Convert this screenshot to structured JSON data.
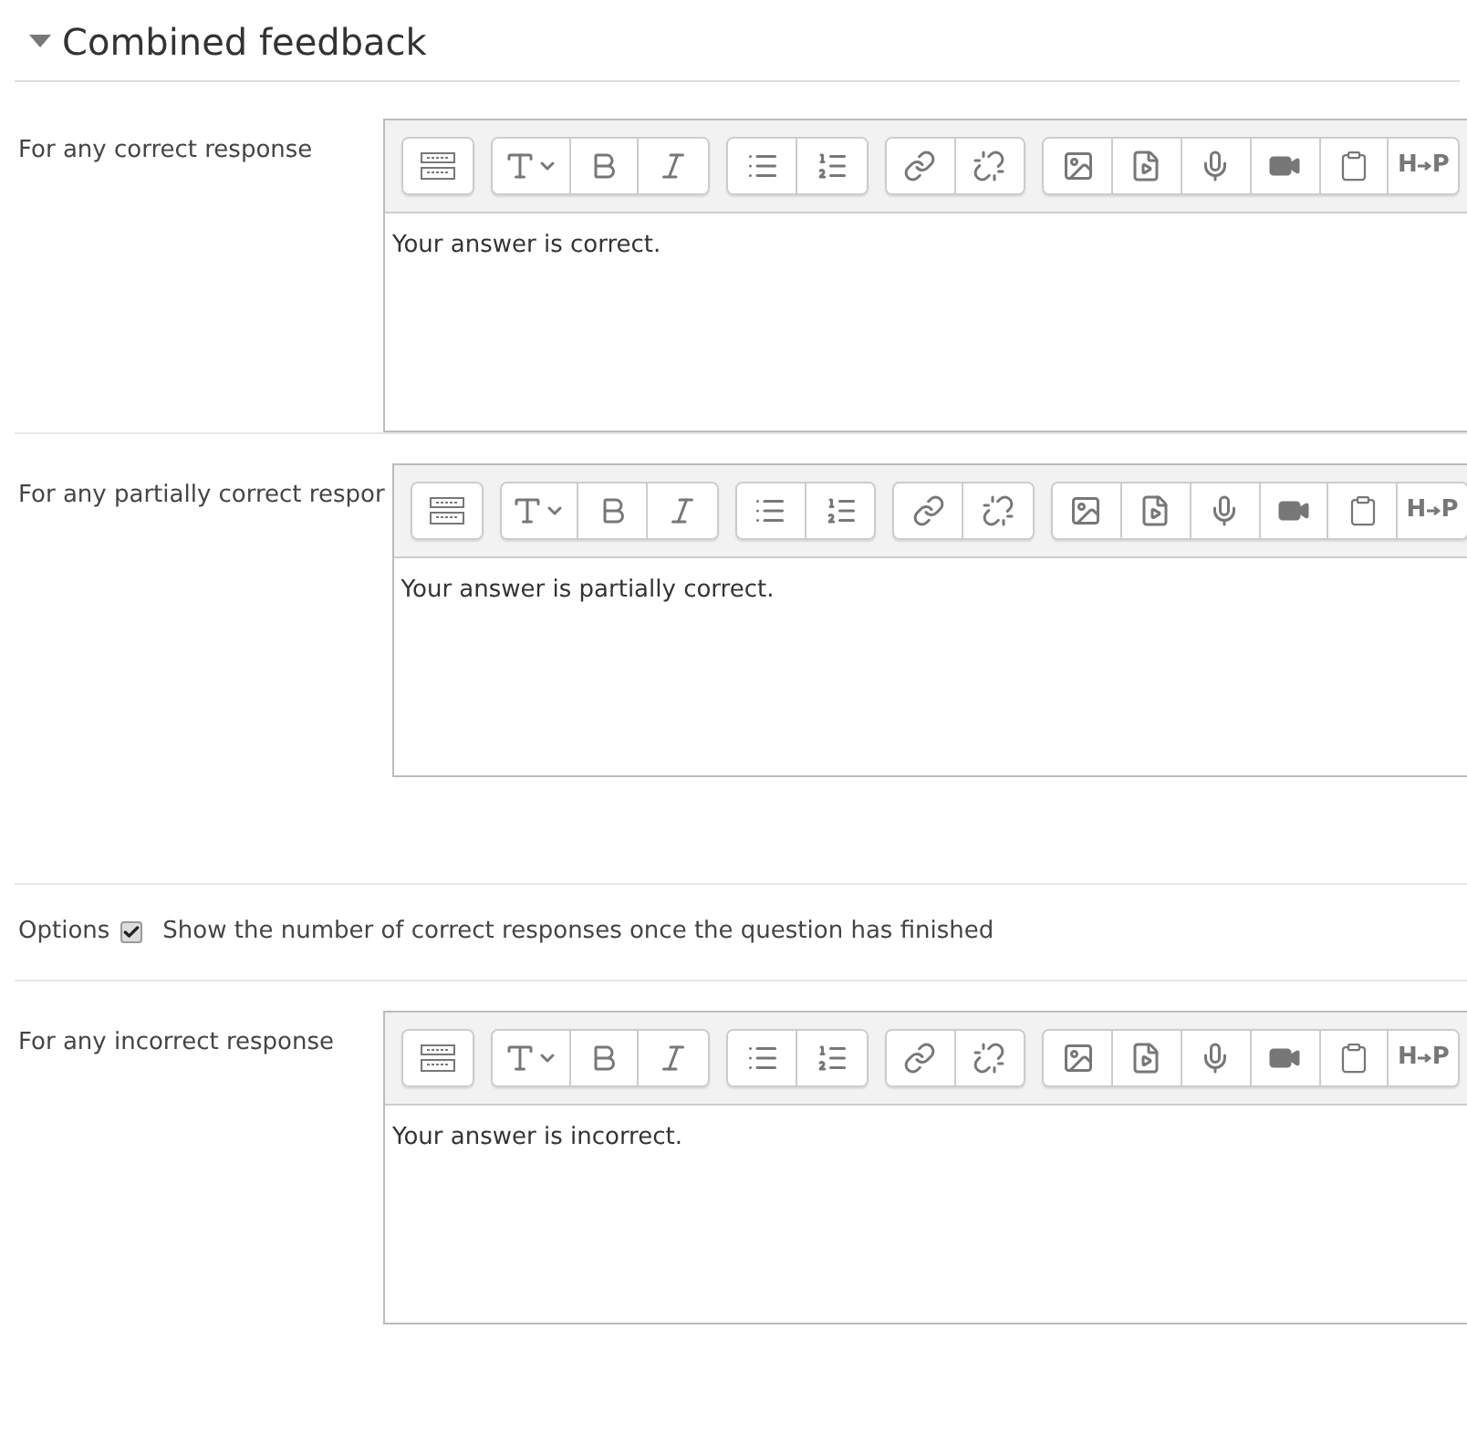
{
  "section": {
    "title": "Combined feedback",
    "expanded": true
  },
  "rows": [
    {
      "kind": "editor",
      "label": "For any correct response",
      "content": "Your answer is correct.",
      "h5p": {
        "left": "H",
        "right": "P"
      }
    },
    {
      "kind": "editor",
      "label": "For any partially correct respor",
      "content": "Your answer is partially correct.",
      "h5p": {
        "left": "H",
        "right": "P"
      }
    },
    {
      "kind": "checkbox",
      "label": "Options",
      "checked": true,
      "text": "Show the number of correct responses once the question has finished"
    },
    {
      "kind": "editor",
      "label": "For any incorrect response",
      "content": "Your answer is incorrect.",
      "h5p": {
        "left": "H",
        "right": "P"
      }
    }
  ]
}
